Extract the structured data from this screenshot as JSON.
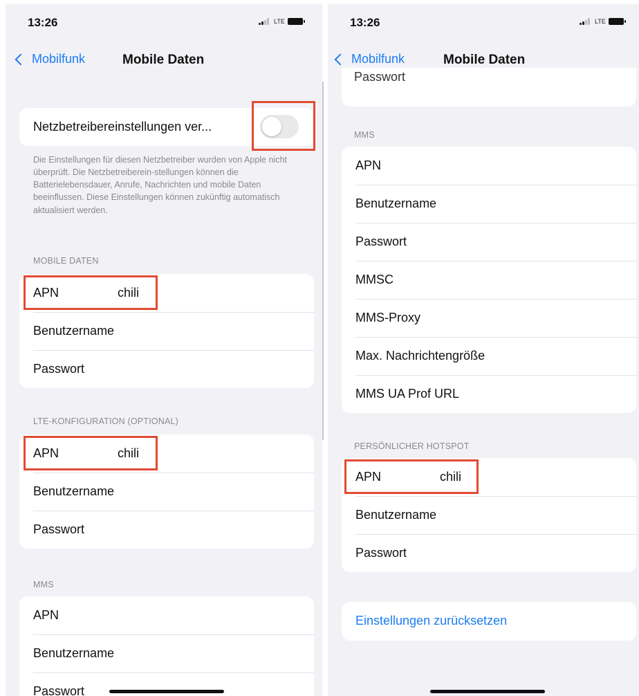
{
  "left": {
    "time": "13:26",
    "network": "LTE",
    "back_label": "Mobilfunk",
    "title": "Mobile Daten",
    "carrier_toggle_label": "Netzbetreibereinstellungen ver...",
    "carrier_toggle_on": false,
    "footer_note": "Die Einstellungen für diesen Netzbetreiber wurden von Apple nicht überprüft. Die Netzbetreiberein-stellungen können die Batterielebensdauer, Anrufe, Nachrichten und mobile Daten beeinflussen. Diese Einstellungen können zukünftig automatisch aktualisiert werden.",
    "mobile_data": {
      "header": "MOBILE DATEN",
      "rows": [
        {
          "label": "APN",
          "value": "chili"
        },
        {
          "label": "Benutzername",
          "value": ""
        },
        {
          "label": "Passwort",
          "value": ""
        }
      ]
    },
    "lte": {
      "header": "LTE-KONFIGURATION (OPTIONAL)",
      "rows": [
        {
          "label": "APN",
          "value": "chili"
        },
        {
          "label": "Benutzername",
          "value": ""
        },
        {
          "label": "Passwort",
          "value": ""
        }
      ]
    },
    "mms": {
      "header": "MMS",
      "rows": [
        {
          "label": "APN"
        },
        {
          "label": "Benutzername"
        },
        {
          "label": "Passwort"
        }
      ]
    }
  },
  "right": {
    "time": "13:26",
    "network": "LTE",
    "back_label": "Mobilfunk",
    "title": "Mobile Daten",
    "partial_row": "Passwort",
    "mms": {
      "header": "MMS",
      "rows": [
        {
          "label": "APN"
        },
        {
          "label": "Benutzername"
        },
        {
          "label": "Passwort"
        },
        {
          "label": "MMSC"
        },
        {
          "label": "MMS-Proxy"
        },
        {
          "label": "Max. Nachrichtengröße"
        },
        {
          "label": "MMS UA Prof URL"
        }
      ]
    },
    "hotspot": {
      "header": "PERSÖNLICHER HOTSPOT",
      "rows": [
        {
          "label": "APN",
          "value": "chili"
        },
        {
          "label": "Benutzername",
          "value": ""
        },
        {
          "label": "Passwort",
          "value": ""
        }
      ]
    },
    "reset_label": "Einstellungen zurücksetzen"
  },
  "colors": {
    "background": "#f2f2f6",
    "link": "#1c7cf4",
    "highlight": "#e24a33",
    "secondary_text": "#8a8a8e"
  },
  "icons": [
    "chevron-left-icon",
    "signal-icon",
    "battery-icon"
  ]
}
